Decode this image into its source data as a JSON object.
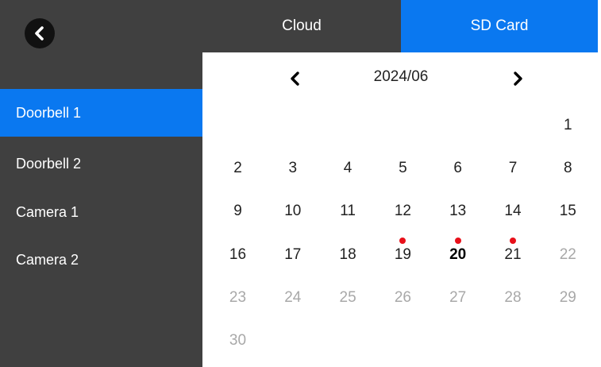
{
  "tabs": [
    {
      "label": "Cloud",
      "active": false
    },
    {
      "label": "SD Card",
      "active": true
    }
  ],
  "devices": [
    {
      "label": "Doorbell 1",
      "active": true
    },
    {
      "label": "Doorbell 2",
      "active": false
    },
    {
      "label": "Camera 1",
      "active": false
    },
    {
      "label": "Camera 2",
      "active": false
    }
  ],
  "calendar": {
    "month_label": "2024/06",
    "first_weekday_index": 6,
    "days": [
      {
        "day": "1",
        "state": "normal",
        "has_recording": false
      },
      {
        "day": "2",
        "state": "normal",
        "has_recording": false
      },
      {
        "day": "3",
        "state": "normal",
        "has_recording": false
      },
      {
        "day": "4",
        "state": "normal",
        "has_recording": false
      },
      {
        "day": "5",
        "state": "normal",
        "has_recording": false
      },
      {
        "day": "6",
        "state": "normal",
        "has_recording": false
      },
      {
        "day": "7",
        "state": "normal",
        "has_recording": false
      },
      {
        "day": "8",
        "state": "normal",
        "has_recording": false
      },
      {
        "day": "9",
        "state": "normal",
        "has_recording": false
      },
      {
        "day": "10",
        "state": "normal",
        "has_recording": false
      },
      {
        "day": "11",
        "state": "normal",
        "has_recording": false
      },
      {
        "day": "12",
        "state": "normal",
        "has_recording": false
      },
      {
        "day": "13",
        "state": "normal",
        "has_recording": false
      },
      {
        "day": "14",
        "state": "normal",
        "has_recording": false
      },
      {
        "day": "15",
        "state": "normal",
        "has_recording": false
      },
      {
        "day": "16",
        "state": "normal",
        "has_recording": false
      },
      {
        "day": "17",
        "state": "normal",
        "has_recording": false
      },
      {
        "day": "18",
        "state": "normal",
        "has_recording": false
      },
      {
        "day": "19",
        "state": "normal",
        "has_recording": true
      },
      {
        "day": "20",
        "state": "selected",
        "has_recording": true
      },
      {
        "day": "21",
        "state": "normal",
        "has_recording": true
      },
      {
        "day": "22",
        "state": "disabled",
        "has_recording": false
      },
      {
        "day": "23",
        "state": "disabled",
        "has_recording": false
      },
      {
        "day": "24",
        "state": "disabled",
        "has_recording": false
      },
      {
        "day": "25",
        "state": "disabled",
        "has_recording": false
      },
      {
        "day": "26",
        "state": "disabled",
        "has_recording": false
      },
      {
        "day": "27",
        "state": "disabled",
        "has_recording": false
      },
      {
        "day": "28",
        "state": "disabled",
        "has_recording": false
      },
      {
        "day": "29",
        "state": "disabled",
        "has_recording": false
      },
      {
        "day": "30",
        "state": "disabled",
        "has_recording": false
      }
    ]
  },
  "icons": {
    "back": "chevron-left-icon",
    "prev_month": "chevron-left-icon",
    "next_month": "chevron-right-icon"
  },
  "colors": {
    "accent": "#0a78f0",
    "panel": "#404040",
    "recording_dot": "#e8101a",
    "disabled_text": "#a8a8a8"
  }
}
